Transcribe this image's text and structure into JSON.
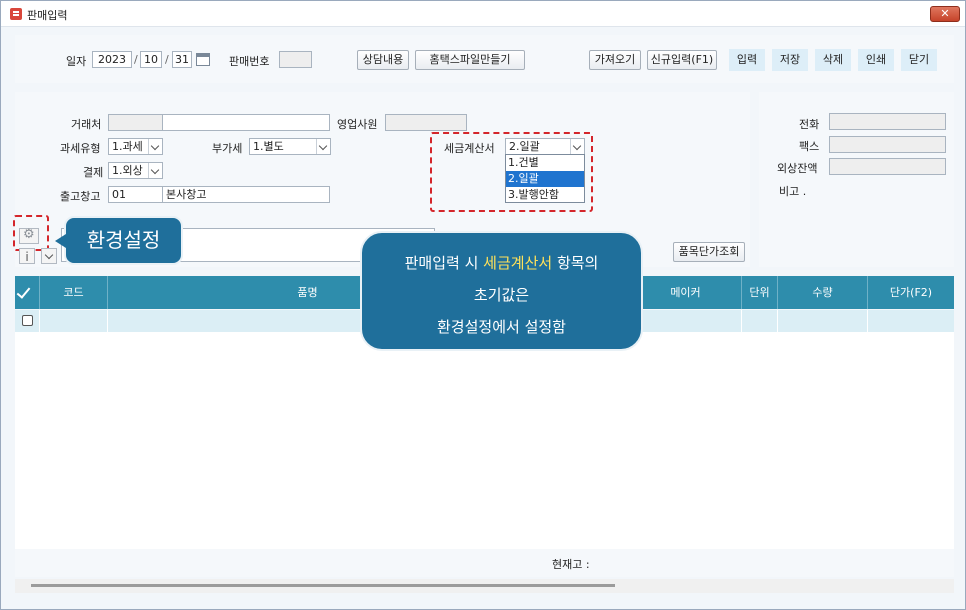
{
  "window": {
    "title": "판매입력",
    "close_label": "✕"
  },
  "header": {
    "date_label": "일자",
    "year": "2023",
    "month": "10",
    "day": "31",
    "date_sep": "/",
    "sale_no_label": "판매번호",
    "sale_no_value": "",
    "buttons": {
      "consult": "상담내용",
      "hometax": "홈택스파일만들기",
      "fetch": "가져오기",
      "new_entry": "신규입력(F1)",
      "input": "입력",
      "save": "저장",
      "delete": "삭제",
      "print": "인쇄",
      "close": "닫기"
    }
  },
  "form": {
    "client_label": "거래처",
    "client_code": "",
    "client_name": "",
    "sales_rep_label": "영업사원",
    "sales_rep_value": "",
    "tax_type_label": "과세유형",
    "tax_type_value": "1.과세",
    "vat_label": "부가세",
    "vat_value": "1.별도",
    "invoice_label": "세금계산서",
    "invoice_value": "2.일괄",
    "invoice_options": [
      "1.건별",
      "2.일괄",
      "3.발행안함"
    ],
    "invoice_selected_index": 1,
    "payment_label": "결제",
    "payment_value": "1.외상",
    "warehouse_label": "출고창고",
    "warehouse_code": "01",
    "warehouse_name": "본사창고",
    "item_price_button": "품목단가조회"
  },
  "right_panel": {
    "phone_label": "전화",
    "fax_label": "팩스",
    "balance_label": "외상잔액",
    "note_label": "비고 ."
  },
  "grid": {
    "columns": [
      "코드",
      "품명",
      "메이커",
      "단위",
      "수량",
      "단가(F2)"
    ]
  },
  "footer": {
    "stock_label": "현재고 :"
  },
  "annotations": {
    "settings_tip": "환경설정",
    "main_tip_line1_pre": "판매입력 시 ",
    "main_tip_line1_hl": "세금계산서",
    "main_tip_line1_post": " 항목의",
    "main_tip_line2": "초기값은",
    "main_tip_line3": "환경설정에서 설정함",
    "highlight_color": "#ffe259",
    "tip_color": "#1f6f9b",
    "dash_color": "#d4262b"
  },
  "icons": {
    "app": "app-icon",
    "calendar": "calendar-icon",
    "settings": "gear-icon",
    "info": "info-icon",
    "check_all": "check-icon"
  }
}
